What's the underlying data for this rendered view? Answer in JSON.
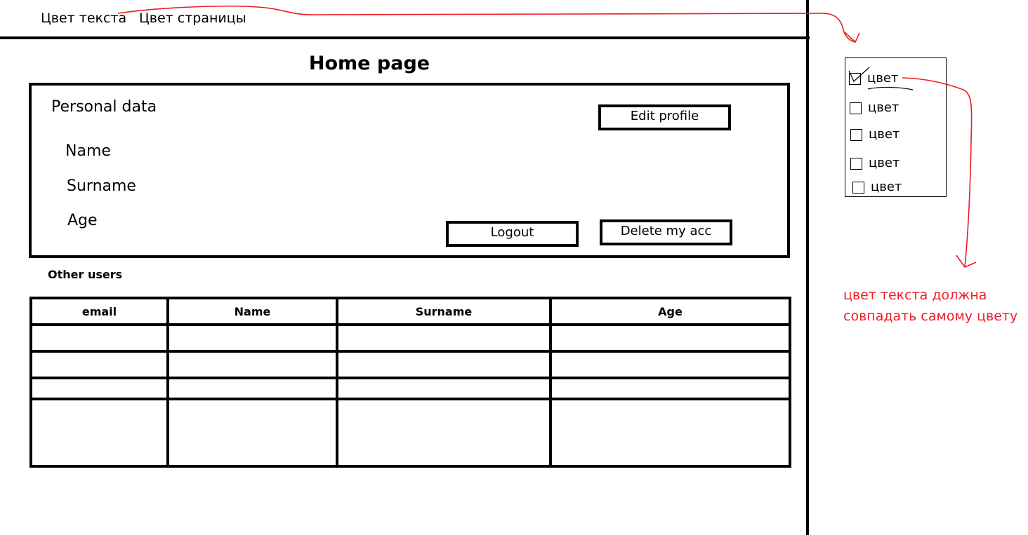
{
  "menu": {
    "text_color_label": "Цвет текста",
    "page_color_label": "Цвет страницы"
  },
  "page_title": "Home page",
  "profile": {
    "heading": "Personal data",
    "fields": [
      "Name",
      "Surname",
      "Age"
    ],
    "edit_button": "Edit profile",
    "logout_button": "Logout",
    "delete_button": "Delete my acc"
  },
  "other_users": {
    "heading": "Other users",
    "columns": [
      "email",
      "Name",
      "Surname",
      "Age"
    ],
    "rows": [
      [
        "",
        "",
        "",
        ""
      ],
      [
        "",
        "",
        "",
        ""
      ],
      [
        "",
        "",
        "",
        ""
      ],
      [
        "",
        "",
        "",
        ""
      ]
    ]
  },
  "color_picker": {
    "options": [
      "цвет",
      "цвет",
      "цвет",
      "цвет",
      "цвет"
    ],
    "checked_index": 0
  },
  "annotation": {
    "line1": "цвет текста должна",
    "line2": "совпадать самому цвету",
    "color": "#ee1c24"
  }
}
